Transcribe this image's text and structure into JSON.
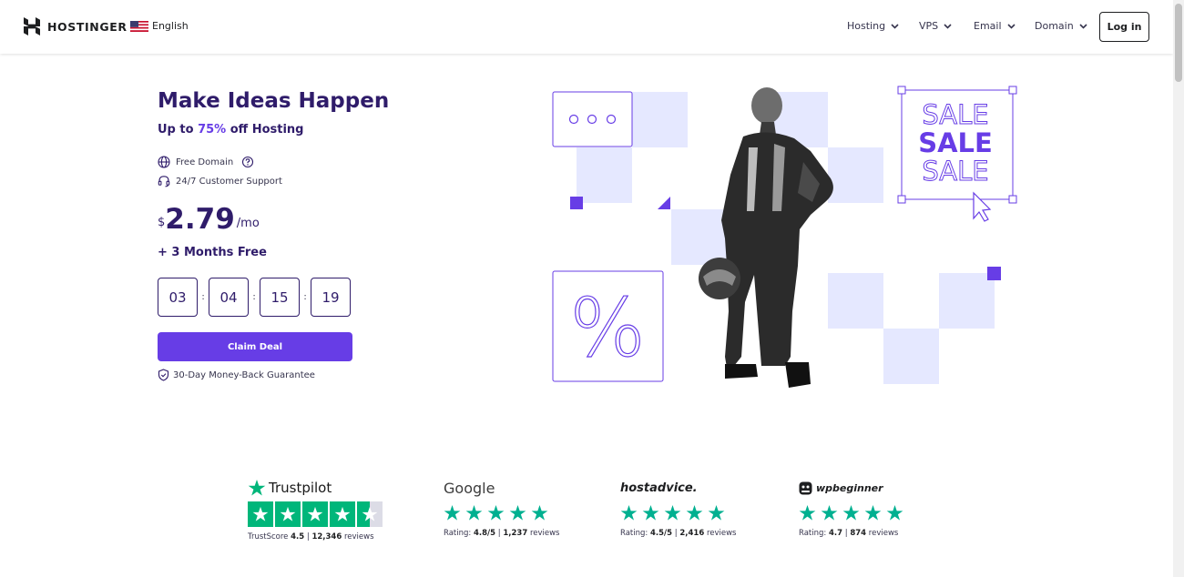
{
  "header": {
    "brand": "HOSTINGER",
    "language": "English",
    "nav": [
      {
        "label": "Hosting"
      },
      {
        "label": "VPS"
      },
      {
        "label": "Email"
      },
      {
        "label": "Domain"
      }
    ],
    "login_label": "Log in"
  },
  "hero": {
    "title": "Make Ideas Happen",
    "subtitle_prefix": "Up to ",
    "subtitle_highlight": "75%",
    "subtitle_suffix": " off Hosting",
    "features": [
      {
        "label": "Free Domain",
        "icon": "globe-icon"
      },
      {
        "label": "24/7 Customer Support",
        "icon": "headset-icon"
      }
    ],
    "price": {
      "currency": "$",
      "amount": "2.79",
      "period": "/mo"
    },
    "bonus": "+ 3 Months Free",
    "timer": [
      "03",
      "04",
      "15",
      "19"
    ],
    "timer_separator": ":",
    "cta_label": "Claim Deal",
    "guarantee": "30-Day Money-Back Guarantee",
    "art": {
      "sale_words": [
        "SALE",
        "SALE",
        "SALE"
      ],
      "percent_symbol": "%"
    }
  },
  "reviews": [
    {
      "brand": "Trustpilot",
      "score_label": "TrustScore",
      "score": "4.5",
      "sep": "|",
      "count": "12,346",
      "count_label": "reviews"
    },
    {
      "brand": "Google",
      "score_label": "Rating:",
      "score": "4.8/5",
      "sep": "|",
      "count": "1,237",
      "count_label": "reviews"
    },
    {
      "brand": "hostadvice.",
      "score_label": "Rating:",
      "score": "4.5/5",
      "sep": "|",
      "count": "2,416",
      "count_label": "reviews"
    },
    {
      "brand": "wpbeginner",
      "score_label": "Rating:",
      "score": "4.7",
      "sep": "|",
      "count": "874",
      "count_label": "reviews"
    }
  ],
  "colors": {
    "primary": "#673de6",
    "dark": "#2f1c6a",
    "light_block": "#e5e8ff",
    "star_green": "#00b67a"
  }
}
